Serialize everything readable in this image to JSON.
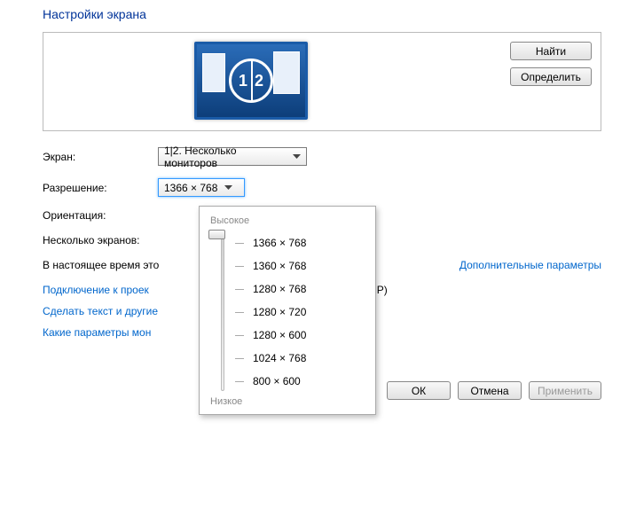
{
  "title": "Настройки экрана",
  "monitor_label": "1|2",
  "buttons": {
    "find": "Найти",
    "identify": "Определить",
    "ok": "ОК",
    "cancel": "Отмена",
    "apply": "Применить"
  },
  "labels": {
    "screen": "Экран:",
    "resolution": "Разрешение:",
    "orientation": "Ориентация:",
    "multiple": "Несколько экранов:"
  },
  "values": {
    "screen": "1|2. Несколько мониторов",
    "resolution": "1366 × 768"
  },
  "current_note_prefix": "В настоящее время это",
  "adv_link": "Дополнительные параметры",
  "links": {
    "projector_prefix": "Подключение к проек",
    "projector_suffix": "оснитесь P)",
    "text_size": "Сделать текст и другие",
    "which_params": "Какие параметры мон"
  },
  "slider": {
    "high": "Высокое",
    "low": "Низкое",
    "options": [
      "1366 × 768",
      "1360 × 768",
      "1280 × 768",
      "1280 × 720",
      "1280 × 600",
      "1024 × 768",
      "800 × 600"
    ]
  }
}
